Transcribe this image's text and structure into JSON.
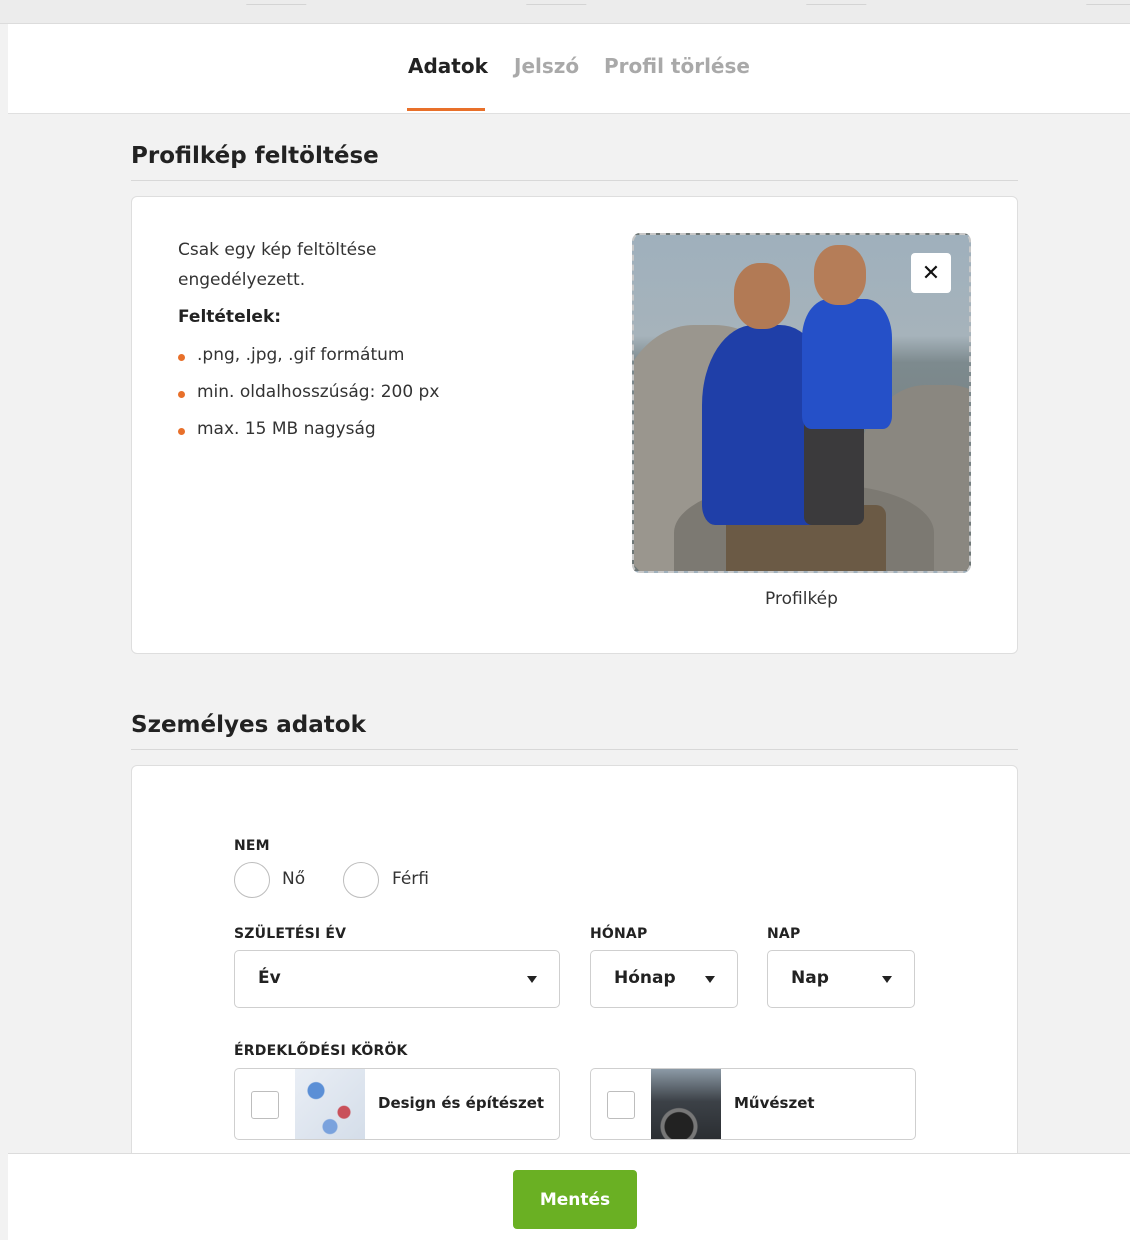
{
  "tabs": {
    "active": "Adatok",
    "password": "Jelszó",
    "delete": "Profil törlése"
  },
  "profile_pic": {
    "section_title": "Profilkép feltöltése",
    "intro": "Csak egy kép feltöltése engedélyezett.",
    "conditions_title": "Feltételek:",
    "conditions": [
      ".png, .jpg, .gif formátum",
      "min. oldalhosszúság: 200 px",
      "max. 15 MB nagyság"
    ],
    "remove_glyph": "✕",
    "caption": "Profilkép"
  },
  "personal": {
    "section_title": "Személyes adatok",
    "gender_label": "NEM",
    "gender_options": [
      "Nő",
      "Férfi"
    ],
    "birth_year_label": "SZÜLETÉSI ÉV",
    "birth_year_value": "Év",
    "month_label": "HÓNAP",
    "month_value": "Hónap",
    "day_label": "NAP",
    "day_value": "Nap",
    "interests_label": "ÉRDEKLŐDÉSI KÖRÖK",
    "interests": [
      "Design és építészet",
      "Művészet"
    ]
  },
  "footer": {
    "save": "Mentés"
  },
  "colors": {
    "accent": "#e8702a",
    "save_button": "#6ab023"
  }
}
